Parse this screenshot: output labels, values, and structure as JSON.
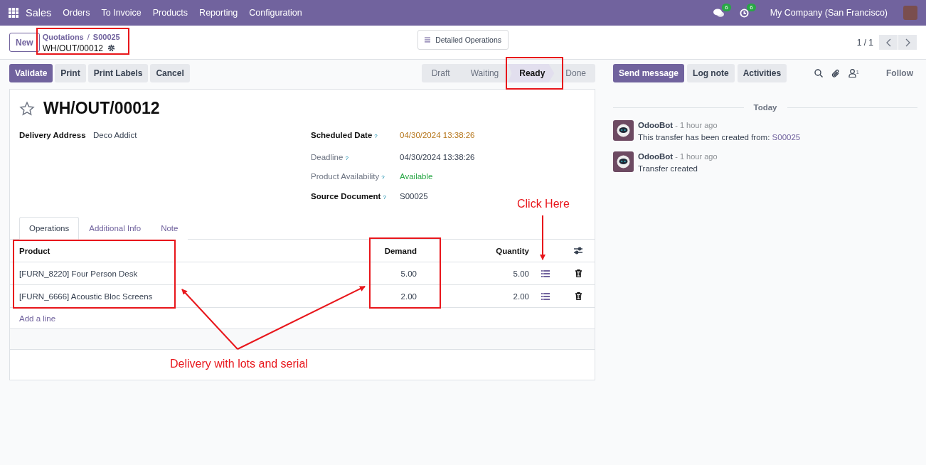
{
  "navbar": {
    "app": "Sales",
    "menu": [
      "Orders",
      "To Invoice",
      "Products",
      "Reporting",
      "Configuration"
    ],
    "messages_count": "6",
    "activities_count": "6",
    "company": "My Company (San Francisco)"
  },
  "control_panel": {
    "new_button": "New",
    "breadcrumb": {
      "parent": "Quotations",
      "separator": "/",
      "record": "S00025",
      "current": "WH/OUT/00012"
    },
    "detailed_operations": "Detailed Operations",
    "pager": "1 / 1"
  },
  "actions": [
    {
      "label": "Validate",
      "kind": "primary"
    },
    {
      "label": "Print",
      "kind": "secondary"
    },
    {
      "label": "Print Labels",
      "kind": "secondary"
    },
    {
      "label": "Cancel",
      "kind": "secondary"
    }
  ],
  "statusbar": [
    {
      "label": "Draft",
      "selected": false
    },
    {
      "label": "Waiting",
      "selected": false
    },
    {
      "label": "Ready",
      "selected": true
    },
    {
      "label": "Done",
      "selected": false
    }
  ],
  "form": {
    "title": "WH/OUT/00012",
    "starred": false,
    "left_fields": [
      {
        "label": "Delivery Address",
        "value": "Deco Addict",
        "required": true
      }
    ],
    "right_fields": [
      {
        "label": "Scheduled Date",
        "help": "?",
        "value": "04/30/2024 13:38:26",
        "required": true,
        "color": "#b5751a"
      },
      {
        "label": "Deadline",
        "help": "?",
        "value": "04/30/2024 13:38:26",
        "required": false
      },
      {
        "label": "Product Availability",
        "help": "?",
        "value": "Available",
        "required": false,
        "color": "#28a745"
      },
      {
        "label": "Source Document",
        "help": "?",
        "value": "S00025",
        "required": true
      }
    ]
  },
  "tabs": [
    {
      "label": "Operations",
      "selected": true
    },
    {
      "label": "Additional Info",
      "selected": false
    },
    {
      "label": "Note",
      "selected": false
    }
  ],
  "table": {
    "columns": [
      "Product",
      "Demand",
      "Quantity"
    ],
    "rows": [
      {
        "product": "[FURN_8220] Four Person Desk",
        "demand": "5.00",
        "quantity": "5.00"
      },
      {
        "product": "[FURN_6666] Acoustic Bloc Screens",
        "demand": "2.00",
        "quantity": "2.00"
      }
    ],
    "add_line": "Add a line"
  },
  "chatter": {
    "buttons": [
      {
        "label": "Send message",
        "kind": "primary"
      },
      {
        "label": "Log note",
        "kind": "secondary"
      },
      {
        "label": "Activities",
        "kind": "secondary"
      }
    ],
    "followers_count": "1",
    "follow": "Follow",
    "separator": "Today",
    "messages": [
      {
        "author": "OdooBot",
        "time": "- 1 hour ago",
        "text": "This transfer has been created from: ",
        "link": "S00025"
      },
      {
        "author": "OdooBot",
        "time": "- 1 hour ago",
        "text": "Transfer created"
      }
    ]
  },
  "annotations": {
    "click_here": "Click Here",
    "caption": "Delivery with lots and serial"
  }
}
